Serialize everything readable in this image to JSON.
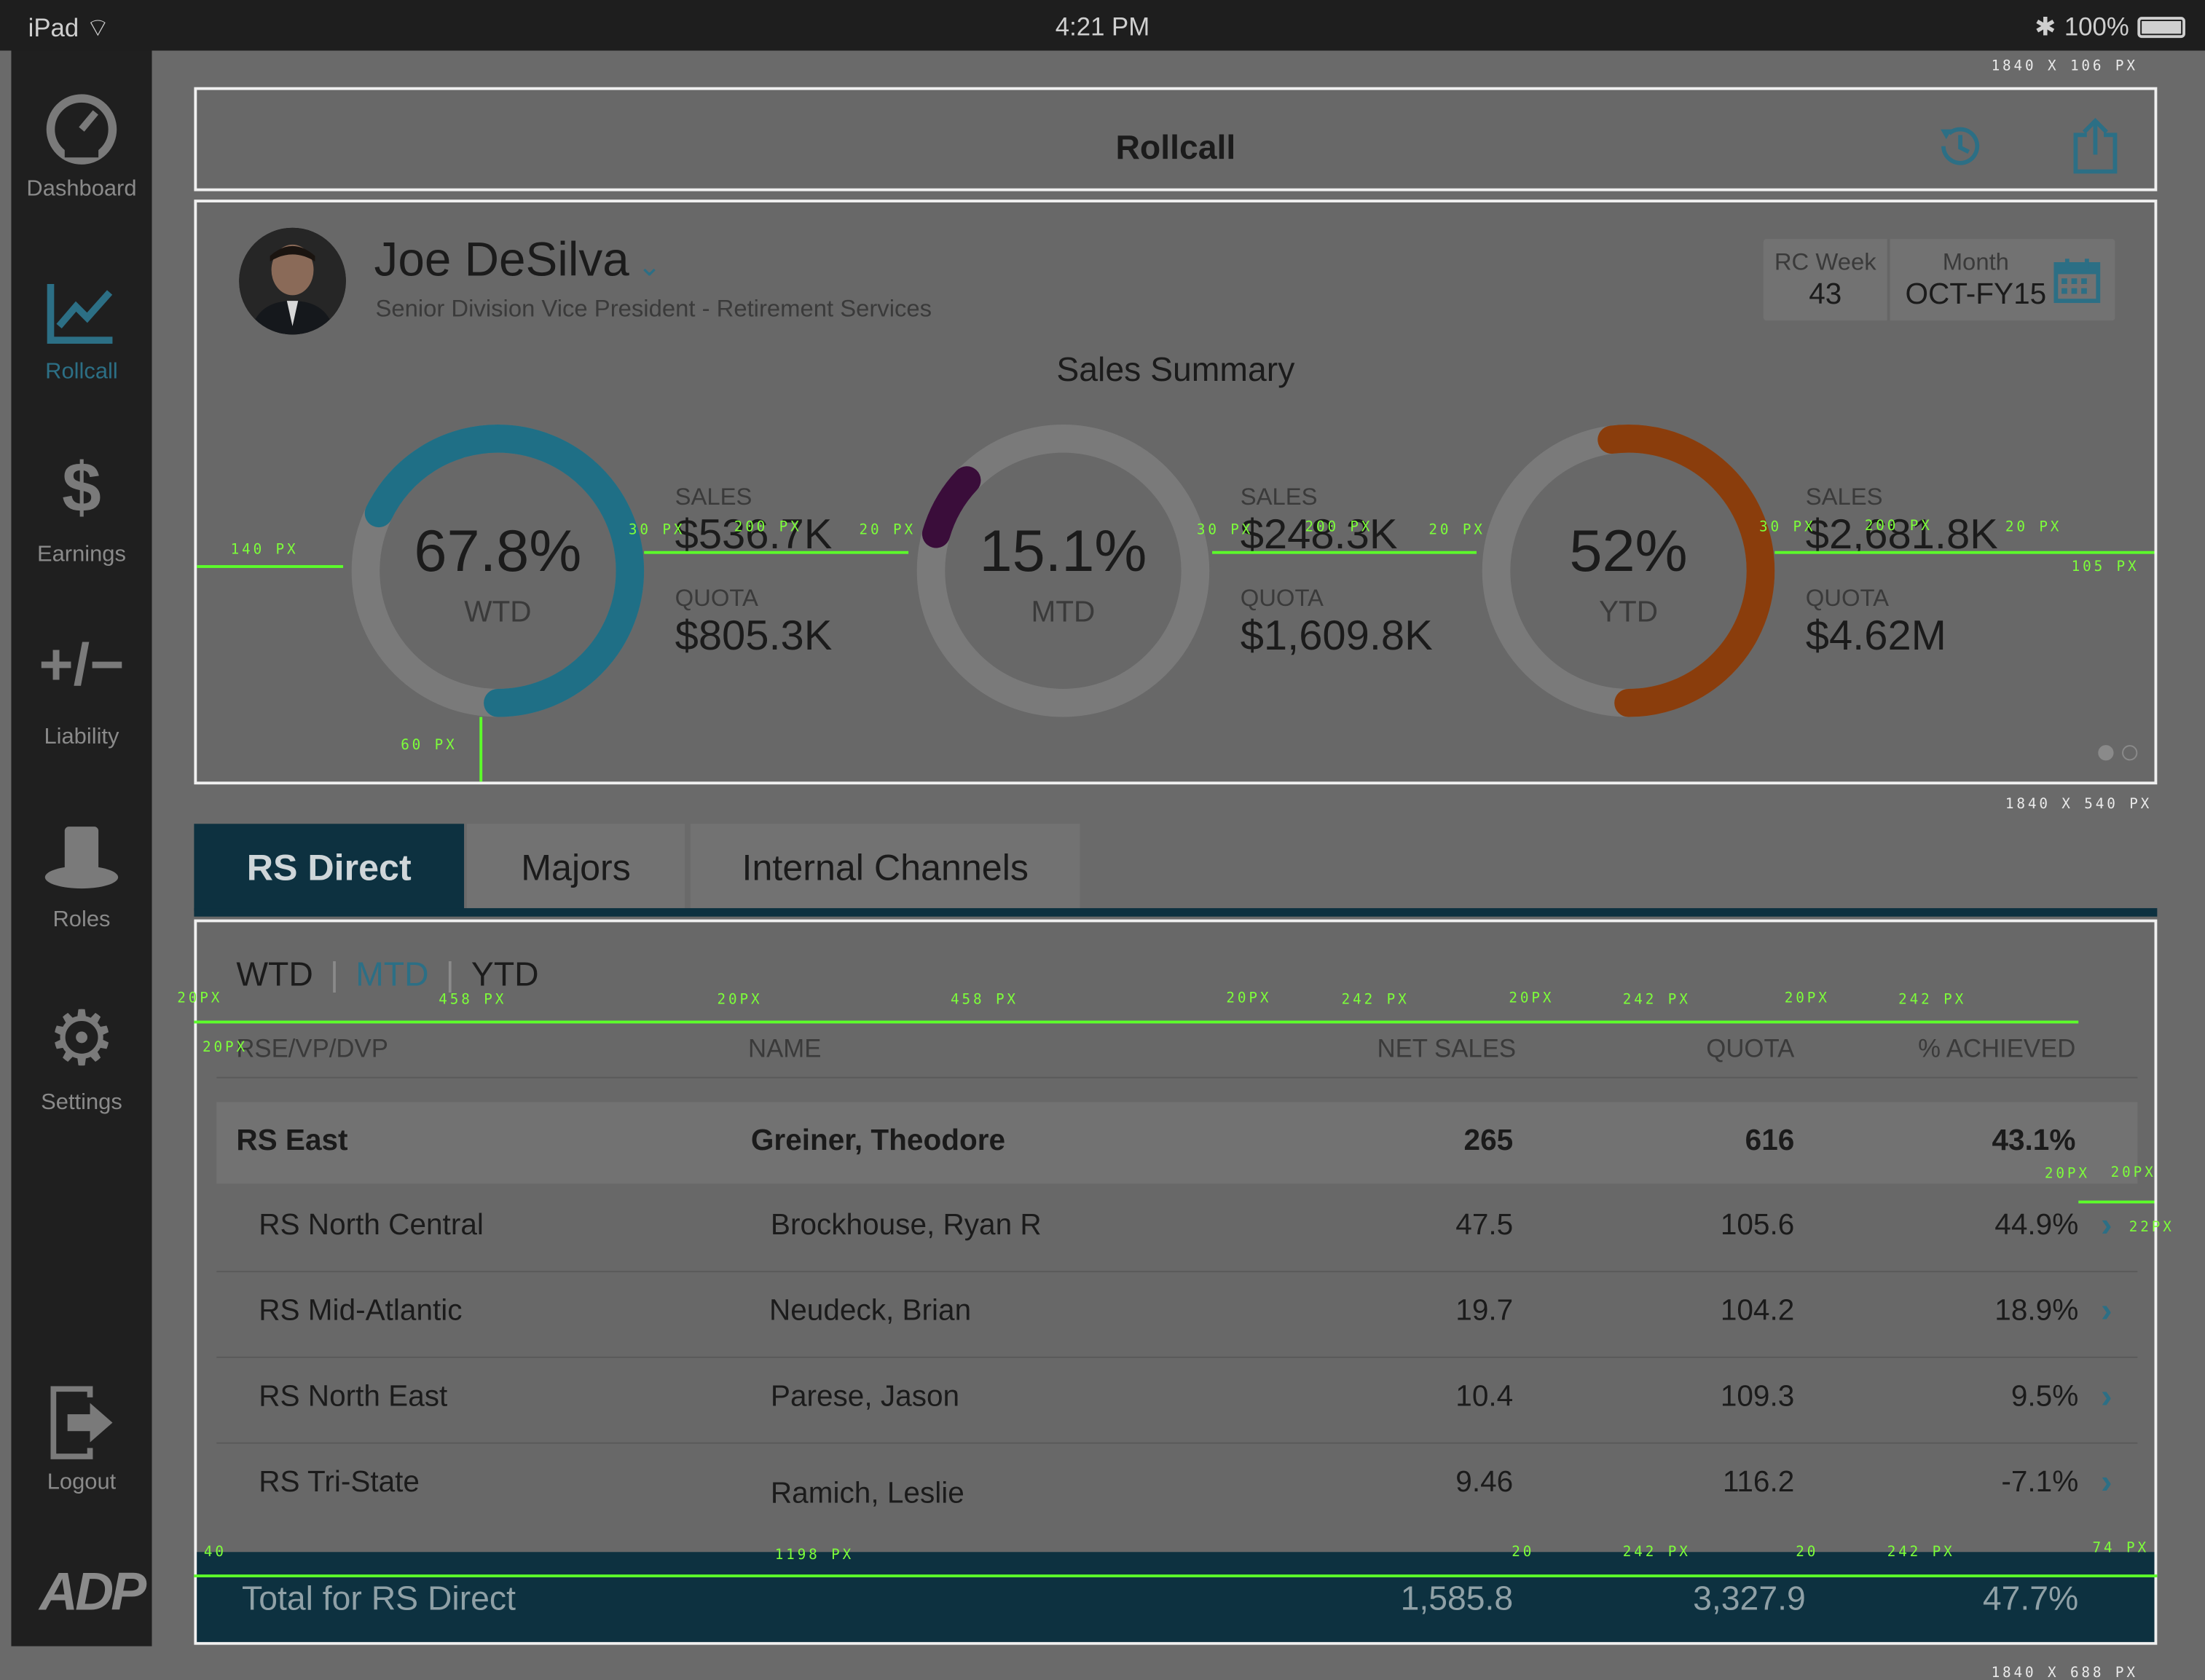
{
  "status_bar": {
    "device": "iPad",
    "time": "4:21 PM",
    "battery": "100%"
  },
  "nav": {
    "items": [
      {
        "label": "Dashboard",
        "icon": "speedometer-icon"
      },
      {
        "label": "Rollcall",
        "icon": "trend-chart-icon",
        "active": true
      },
      {
        "label": "Earnings",
        "icon": "dollar-icon"
      },
      {
        "label": "Liability",
        "icon": "plus-minus-icon"
      },
      {
        "label": "Roles",
        "icon": "top-hat-icon"
      },
      {
        "label": "Settings",
        "icon": "gear-icon"
      },
      {
        "label": "Logout",
        "icon": "logout-icon"
      }
    ],
    "logo": "ADP"
  },
  "header": {
    "title": "Rollcall"
  },
  "profile": {
    "name": "Joe DeSilva",
    "title": "Senior Division Vice President - Retirement Services",
    "rc_week_label": "RC Week",
    "rc_week": "43",
    "month_label": "Month",
    "month": "OCT-FY15"
  },
  "summary": {
    "title": "Sales Summary",
    "cards": [
      {
        "pct": "67.8%",
        "period": "WTD",
        "sales_label": "SALES",
        "sales": "$536.7K",
        "quota_label": "QUOTA",
        "quota": "$805.3K",
        "progress": 0.678,
        "color": "#1f6f86"
      },
      {
        "pct": "15.1%",
        "period": "MTD",
        "sales_label": "SALES",
        "sales": "$248.3K",
        "quota_label": "QUOTA",
        "quota": "$1,609.8K",
        "progress": 0.151,
        "color": "#3a0d3a"
      },
      {
        "pct": "52%",
        "period": "YTD",
        "sales_label": "SALES",
        "sales": "$2,681.8K",
        "quota_label": "QUOTA",
        "quota": "$4.62M",
        "progress": 0.52,
        "color": "#8a3d0c"
      }
    ]
  },
  "tabs": [
    "RS Direct",
    "Majors",
    "Internal Channels"
  ],
  "periods": [
    "WTD",
    "MTD",
    "YTD"
  ],
  "table": {
    "headers": [
      "RSE/VP/DVP",
      "NAME",
      "NET SALES",
      "QUOTA",
      "% ACHIEVED"
    ],
    "rows": [
      {
        "region": "RS East",
        "name": "Greiner, Theodore",
        "net": "265",
        "quota": "616",
        "pct": "43.1%",
        "group": true
      },
      {
        "region": "RS North Central",
        "name": "Brockhouse, Ryan R",
        "net": "47.5",
        "quota": "105.6",
        "pct": "44.9%"
      },
      {
        "region": "RS Mid-Atlantic",
        "name": "Neudeck, Brian",
        "net": "19.7",
        "quota": "104.2",
        "pct": "18.9%"
      },
      {
        "region": "RS North East",
        "name": "Parese, Jason",
        "net": "10.4",
        "quota": "109.3",
        "pct": "9.5%"
      },
      {
        "region": "RS Tri-State",
        "name": "Ramich, Leslie",
        "net": "9.46",
        "quota": "116.2",
        "pct": "-7.1%"
      }
    ],
    "total": {
      "label": "Total for RS Direct",
      "net": "1,585.8",
      "quota": "3,327.9",
      "pct": "47.7%"
    }
  },
  "spec": {
    "header_size": "1840 X 106 PX",
    "card_size": "1840 X 540 PX",
    "table_size": "1840 X 688 PX",
    "m140": "140 PX",
    "m60": "60 PX",
    "m30": "30 PX",
    "m200": "200 PX",
    "m20": "20 PX",
    "m105": "105 PX",
    "m20px": "20PX",
    "m458": "458 PX",
    "m242": "242 PX",
    "m22px": "22PX",
    "t40": "40",
    "t1198": "1198 PX",
    "t20": "20",
    "t74": "74 PX"
  }
}
